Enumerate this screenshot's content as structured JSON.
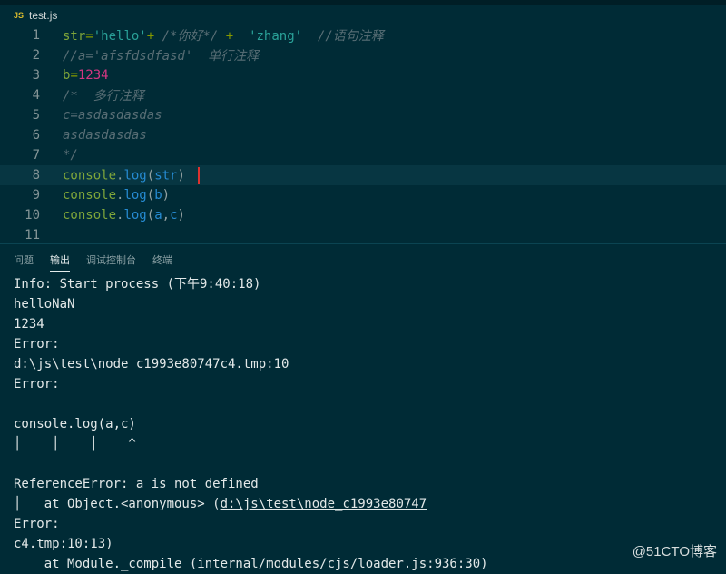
{
  "tab": {
    "icon_label": "JS",
    "filename": "test.js"
  },
  "editor": {
    "lines": [
      {
        "n": "1",
        "parts": [
          [
            "kw",
            "str"
          ],
          [
            "op",
            "="
          ],
          [
            "str",
            "'hello'"
          ],
          [
            "op",
            "+"
          ],
          [
            "cm",
            " /*你好*/ "
          ],
          [
            "op",
            "+"
          ],
          [
            "txt",
            "  "
          ],
          [
            "str",
            "'zhang'"
          ],
          [
            "txt",
            "  "
          ],
          [
            "cm",
            "//语句注释"
          ]
        ]
      },
      {
        "n": "2",
        "parts": [
          [
            "cm",
            "//a='afsfdsdfasd'  单行注释"
          ]
        ]
      },
      {
        "n": "3",
        "parts": [
          [
            "kw",
            "b"
          ],
          [
            "op",
            "="
          ],
          [
            "num",
            "1234"
          ]
        ]
      },
      {
        "n": "4",
        "parts": [
          [
            "cm",
            "/*  多行注释"
          ]
        ]
      },
      {
        "n": "5",
        "parts": [
          [
            "cm",
            "c=asdasdasdas"
          ]
        ]
      },
      {
        "n": "6",
        "parts": [
          [
            "cm",
            "asdasdasdas"
          ]
        ]
      },
      {
        "n": "7",
        "parts": [
          [
            "cm",
            "*/"
          ]
        ]
      },
      {
        "n": "8",
        "parts": [
          [
            "kw",
            "console"
          ],
          [
            "txt",
            "."
          ],
          [
            "fn",
            "log"
          ],
          [
            "txt",
            "("
          ],
          [
            "fn",
            "str"
          ],
          [
            "txt",
            ")"
          ]
        ],
        "current": true
      },
      {
        "n": "9",
        "parts": [
          [
            "kw",
            "console"
          ],
          [
            "txt",
            "."
          ],
          [
            "fn",
            "log"
          ],
          [
            "txt",
            "("
          ],
          [
            "fn",
            "b"
          ],
          [
            "txt",
            ")"
          ]
        ]
      },
      {
        "n": "10",
        "parts": [
          [
            "kw",
            "console"
          ],
          [
            "txt",
            "."
          ],
          [
            "fn",
            "log"
          ],
          [
            "txt",
            "("
          ],
          [
            "fn",
            "a"
          ],
          [
            "txt",
            ","
          ],
          [
            "fn",
            "c"
          ],
          [
            "txt",
            ")"
          ]
        ]
      },
      {
        "n": "11",
        "parts": []
      }
    ]
  },
  "panel": {
    "tabs": [
      {
        "label": "问题",
        "active": false
      },
      {
        "label": "输出",
        "active": true
      },
      {
        "label": "调试控制台",
        "active": false
      },
      {
        "label": "终端",
        "active": false
      }
    ]
  },
  "output": {
    "lines": [
      "Info: Start process (下午9:40:18)",
      "helloNaN",
      "1234",
      "Error:",
      "d:\\js\\test\\node_c1993e80747c4.tmp:10",
      "Error:",
      "",
      "console.log(a,c)",
      "│    │    │    ^",
      "",
      "ReferenceError: a is not defined",
      "│   at Object.<anonymous> (d:\\js\\test\\node_c1993e80747",
      "Error:",
      "c4.tmp:10:13)",
      "    at Module._compile (internal/modules/cjs/loader.js:936:30)"
    ]
  },
  "watermark": "@51CTO博客"
}
